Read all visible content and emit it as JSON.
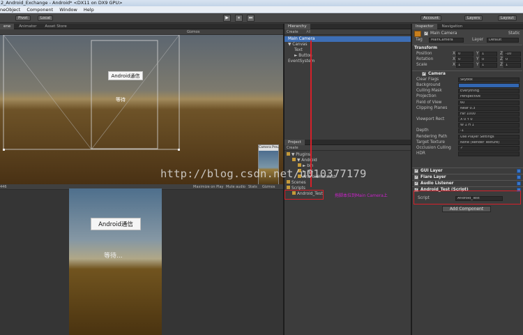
{
  "window_title": "2_Android_Exchange - Android* <DX11 on DX9 GPU>",
  "menu": [
    "neObject",
    "Component",
    "Window",
    "Help"
  ],
  "toolbar": {
    "pivot": "Pivot",
    "local": "Local",
    "play": "▶",
    "pause": "⏸",
    "step": "⏭",
    "account": "Account",
    "layers": "Layers",
    "layout": "Layout"
  },
  "scene": {
    "tabs": [
      "ene",
      "Animator",
      "Asset Store"
    ],
    "gizmos": "Gizmos",
    "button_text": "Android通信",
    "wait_text": "等待",
    "camera_preview_label": "Camera Preview"
  },
  "game": {
    "left_value": "446",
    "controls": [
      "Maximize on Play",
      "Mute audio",
      "Stats",
      "Gizmos"
    ],
    "button_text": "Android通信",
    "wait_text": "等待..."
  },
  "hierarchy": {
    "title": "Hierarchy",
    "create": "Create",
    "search_hint": "All",
    "items": [
      {
        "label": "Main Camera",
        "indent": 0,
        "selected": true
      },
      {
        "label": "▼ Canvas",
        "indent": 0,
        "selected": false
      },
      {
        "label": "Text",
        "indent": 1,
        "selected": false
      },
      {
        "label": "► Button",
        "indent": 1,
        "selected": false
      },
      {
        "label": "EventSystem",
        "indent": 0,
        "selected": false
      }
    ]
  },
  "project": {
    "title": "Project",
    "create": "Create",
    "items": [
      {
        "label": "▼ Plugins",
        "indent": 0
      },
      {
        "label": "▼ Android",
        "indent": 1
      },
      {
        "label": "► bin",
        "indent": 2
      },
      {
        "label": "► res",
        "indent": 2
      },
      {
        "label": "AndroidManifest",
        "indent": 2
      },
      {
        "label": "Scenes",
        "indent": 0
      },
      {
        "label": "Scripts",
        "indent": 0
      },
      {
        "label": "Android_Test",
        "indent": 1
      }
    ],
    "annotation": "拖脚本拉到Main Camera上"
  },
  "inspector": {
    "tabs": [
      "Inspector",
      "Navigation"
    ],
    "object_name": "Main Camera",
    "static_label": "Static",
    "tag_label": "Tag",
    "tag_value": "MainCamera",
    "layer_label": "Layer",
    "layer_value": "Default",
    "transform": {
      "title": "Transform",
      "rows": [
        {
          "label": "Position",
          "x": "0",
          "y": "1",
          "z": "-10"
        },
        {
          "label": "Rotation",
          "x": "0",
          "y": "0",
          "z": "0"
        },
        {
          "label": "Scale",
          "x": "1",
          "y": "1",
          "z": "1"
        }
      ]
    },
    "camera": {
      "title": "Camera",
      "rows": [
        {
          "label": "Clear Flags",
          "value": "Skybox"
        },
        {
          "label": "Background",
          "value": ""
        },
        {
          "label": "Culling Mask",
          "value": "Everything"
        },
        {
          "label": "Projection",
          "value": "Perspective"
        },
        {
          "label": "Field of View",
          "value": "60"
        },
        {
          "label": "Clipping Planes",
          "value": "Near  0.3"
        },
        {
          "label": "",
          "value": "Far   1000"
        },
        {
          "label": "Viewport Rect",
          "value": "X 0   Y 0"
        },
        {
          "label": "",
          "value": "W 1   H 1"
        },
        {
          "label": "Depth",
          "value": "-1"
        },
        {
          "label": "Rendering Path",
          "value": "Use Player Settings"
        },
        {
          "label": "Target Texture",
          "value": "None (Render Texture)"
        },
        {
          "label": "Occlusion Culling",
          "value": "✓"
        },
        {
          "label": "HDR",
          "value": ""
        }
      ]
    },
    "components": [
      "GUI Layer",
      "Flare Layer",
      "Audio Listener",
      "Android_Test (Script)"
    ],
    "script_label": "Script",
    "script_value": "Android_Test",
    "add_component": "Add Component"
  },
  "watermark": "http://blog.csdn.net/u010377179",
  "colors": {
    "highlight_red": "#d8202a",
    "selection_blue": "#3d6eb5",
    "annotation_magenta": "#cc22cc"
  }
}
